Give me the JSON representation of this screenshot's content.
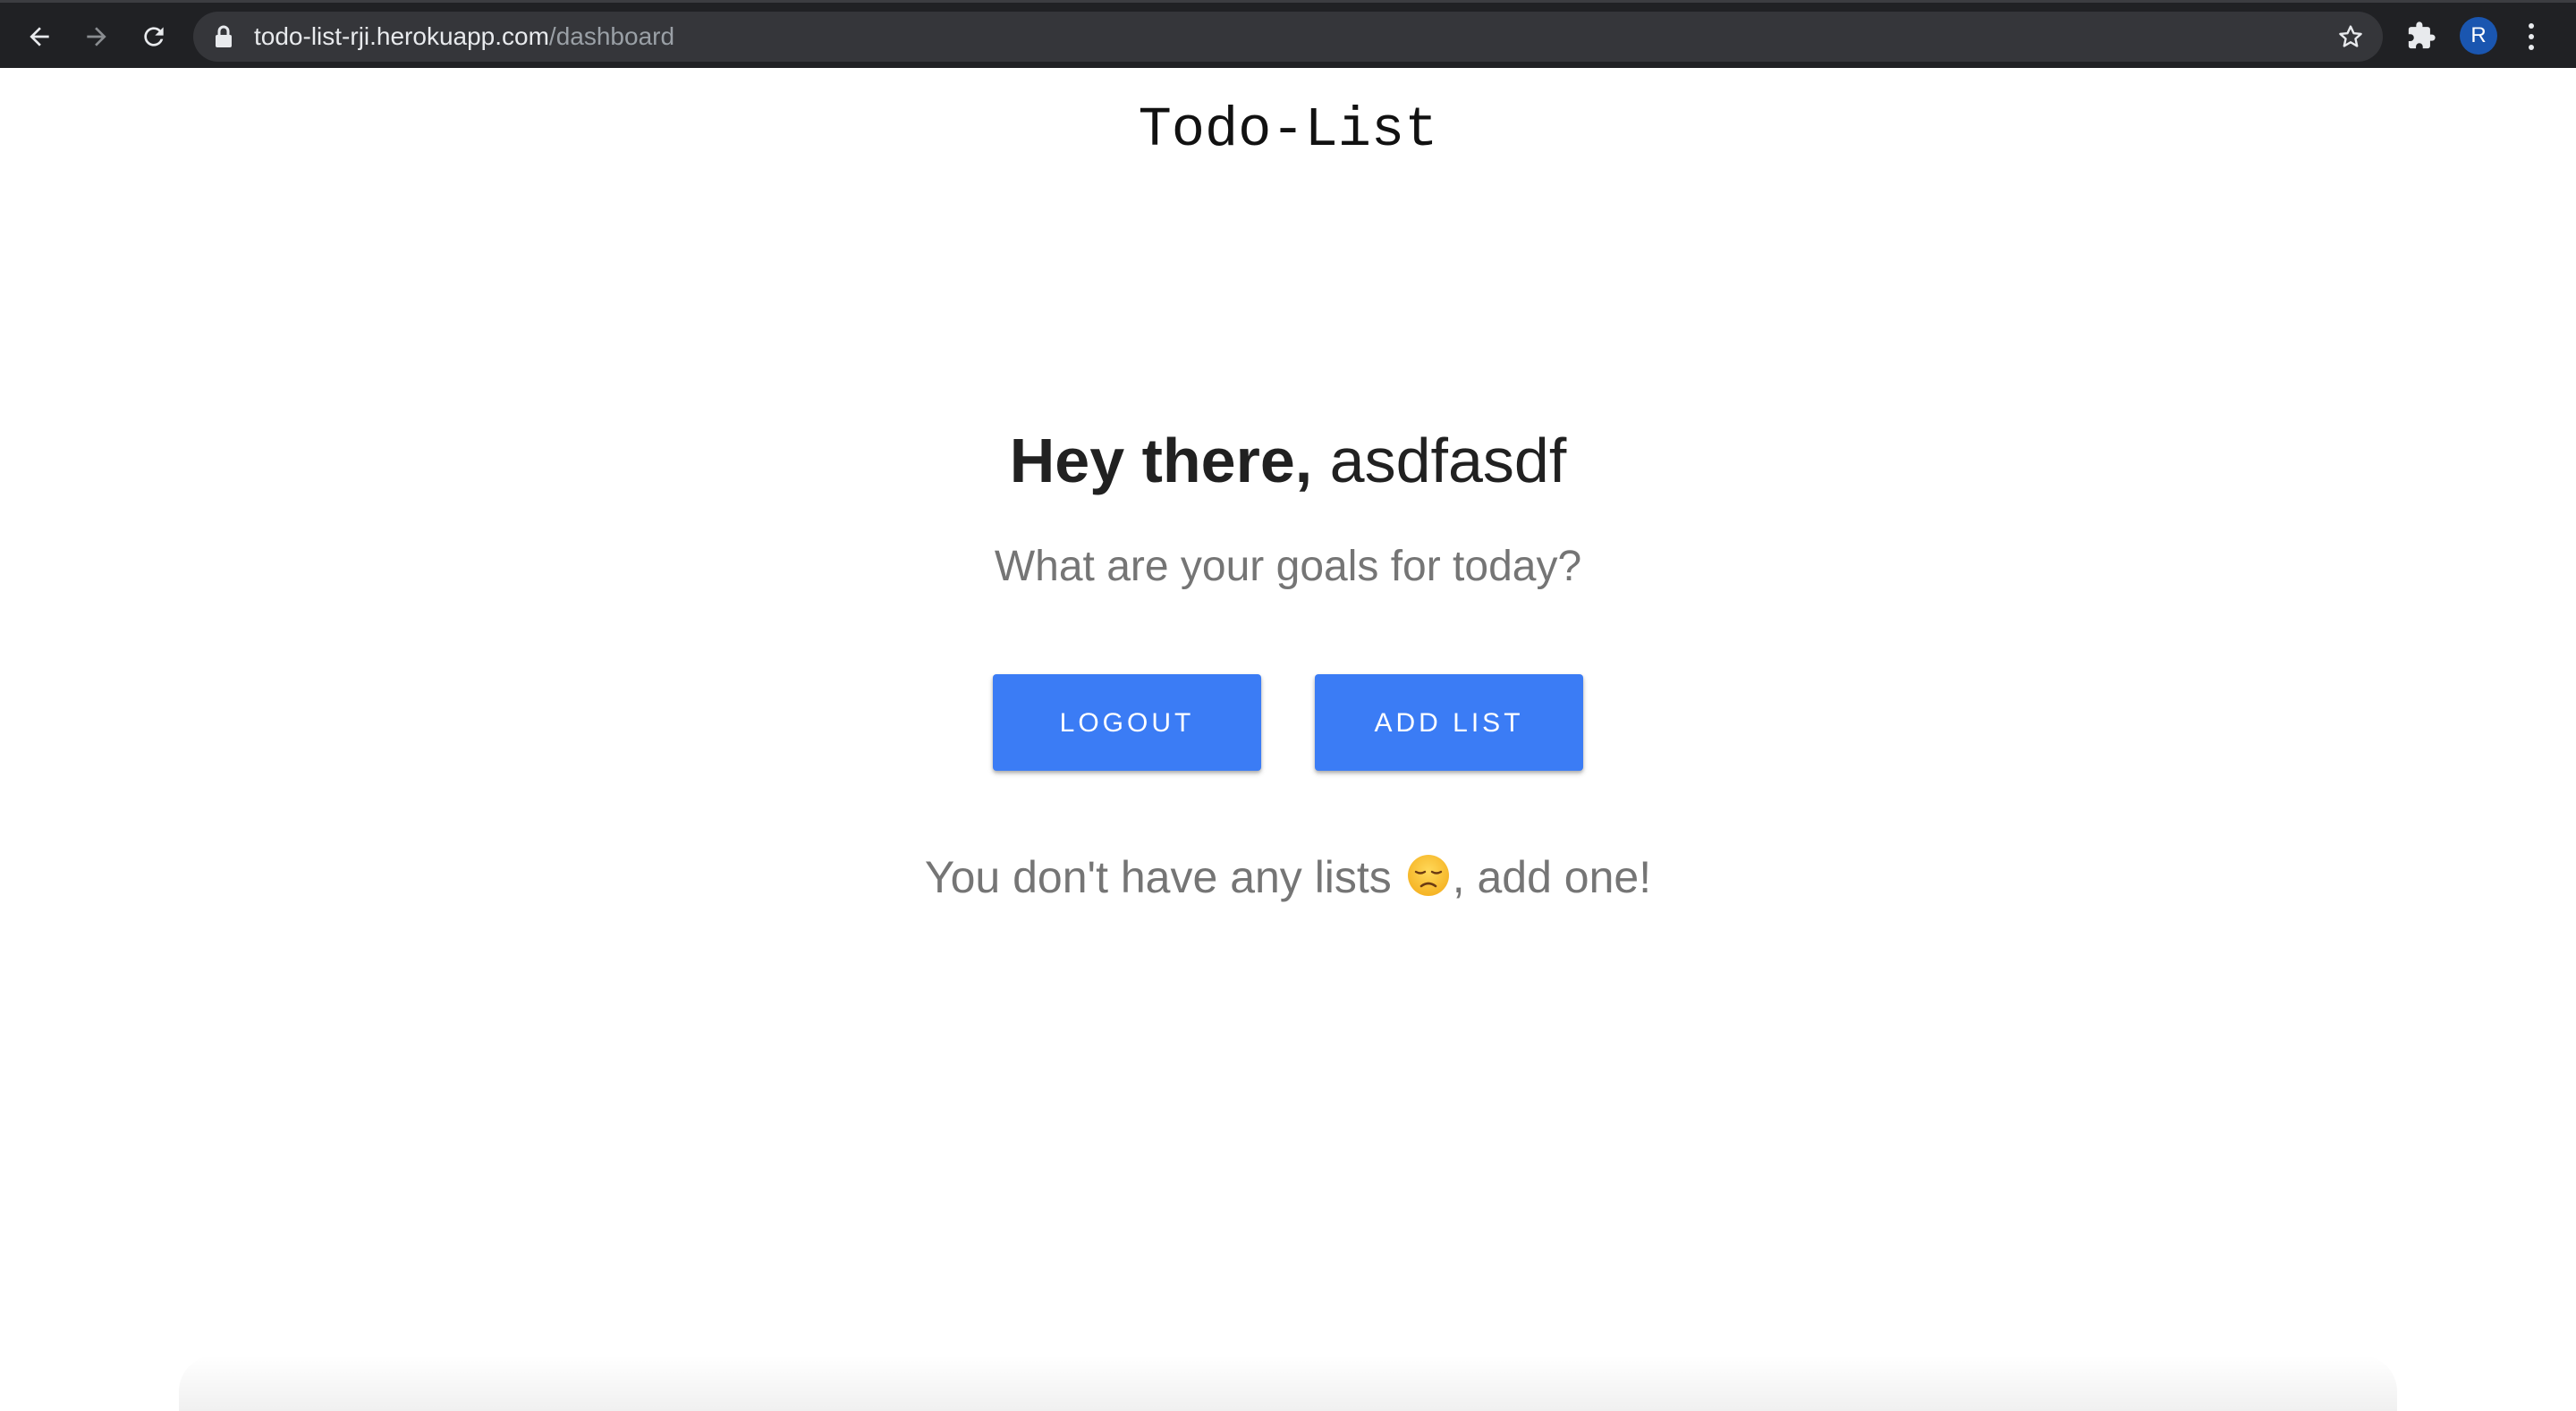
{
  "browser": {
    "url_host": "todo-list-rji.herokuapp.com",
    "url_path": "/dashboard",
    "profile_initial": "R",
    "icons": [
      "back-arrow-icon",
      "forward-arrow-icon",
      "reload-icon",
      "lock-icon",
      "star-icon",
      "extensions-icon",
      "menu-dots-icon"
    ],
    "colors": {
      "chrome_bg": "#202124",
      "omnibox_bg": "#35363a",
      "avatar_bg": "#1a56b0"
    }
  },
  "app": {
    "title": "Todo-List"
  },
  "dashboard": {
    "greeting_prefix": "Hey there,",
    "username": "asdfasdf",
    "subtitle": "What are your goals for today?",
    "logout_label": "LOGOUT",
    "add_list_label": "ADD LIST",
    "empty_text_before": "You don't have any lists ",
    "empty_emoji": "disappointed-face-emoji",
    "empty_text_after": ", add one!",
    "colors": {
      "button": "#3b7cf5",
      "button_text": "#ffffff",
      "muted_text": "#757575"
    }
  }
}
